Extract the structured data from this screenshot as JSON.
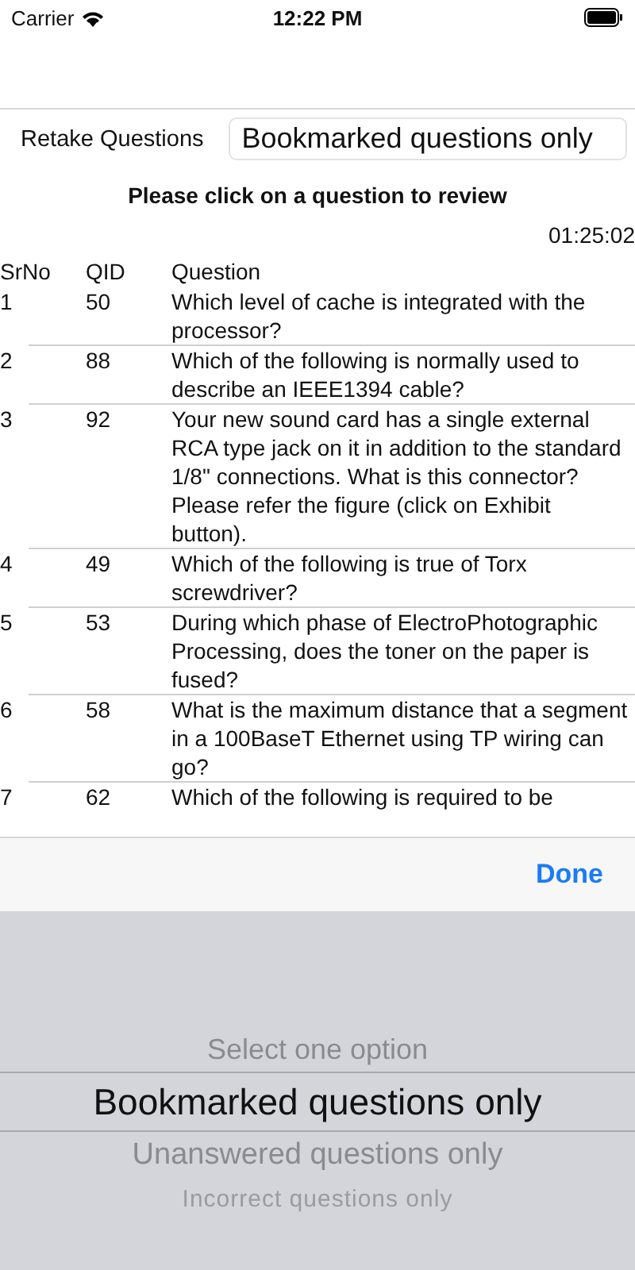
{
  "status_bar": {
    "carrier": "Carrier",
    "time": "12:22 PM"
  },
  "filter": {
    "label": "Retake Questions",
    "value": "Bookmarked questions only"
  },
  "instruction": "Please click on a question to review",
  "timer": "01:25:02",
  "table": {
    "columns": [
      "SrNo",
      "QID",
      "Question"
    ],
    "rows": [
      {
        "srno": "1",
        "qid": "50",
        "question": "Which level of cache is integrated with the processor?"
      },
      {
        "srno": "2",
        "qid": "88",
        "question": "Which of the following is normally used to describe an IEEE1394 cable?"
      },
      {
        "srno": "3",
        "qid": "92",
        "question": "Your new sound card has a single external RCA type jack on it in addition to the standard 1/8\" connections. What is this connector? Please refer the figure (click on Exhibit button)."
      },
      {
        "srno": "4",
        "qid": "49",
        "question": "Which of the following is true of Torx screwdriver?"
      },
      {
        "srno": "5",
        "qid": "53",
        "question": "During which phase of ElectroPhotographic Processing, does the toner on the paper is fused?"
      },
      {
        "srno": "6",
        "qid": "58",
        "question": "What is the maximum distance that a segment in a 100BaseT Ethernet using TP wiring can go?"
      },
      {
        "srno": "7",
        "qid": "62",
        "question": "Which of the following is required to be"
      }
    ]
  },
  "toolbar": {
    "done": "Done"
  },
  "picker": {
    "options": [
      {
        "label": "Select one option",
        "selected": false
      },
      {
        "label": "Bookmarked questions only",
        "selected": true
      },
      {
        "label": "Unanswered questions only",
        "selected": false
      },
      {
        "label": "Incorrect questions only",
        "selected": false
      }
    ]
  }
}
